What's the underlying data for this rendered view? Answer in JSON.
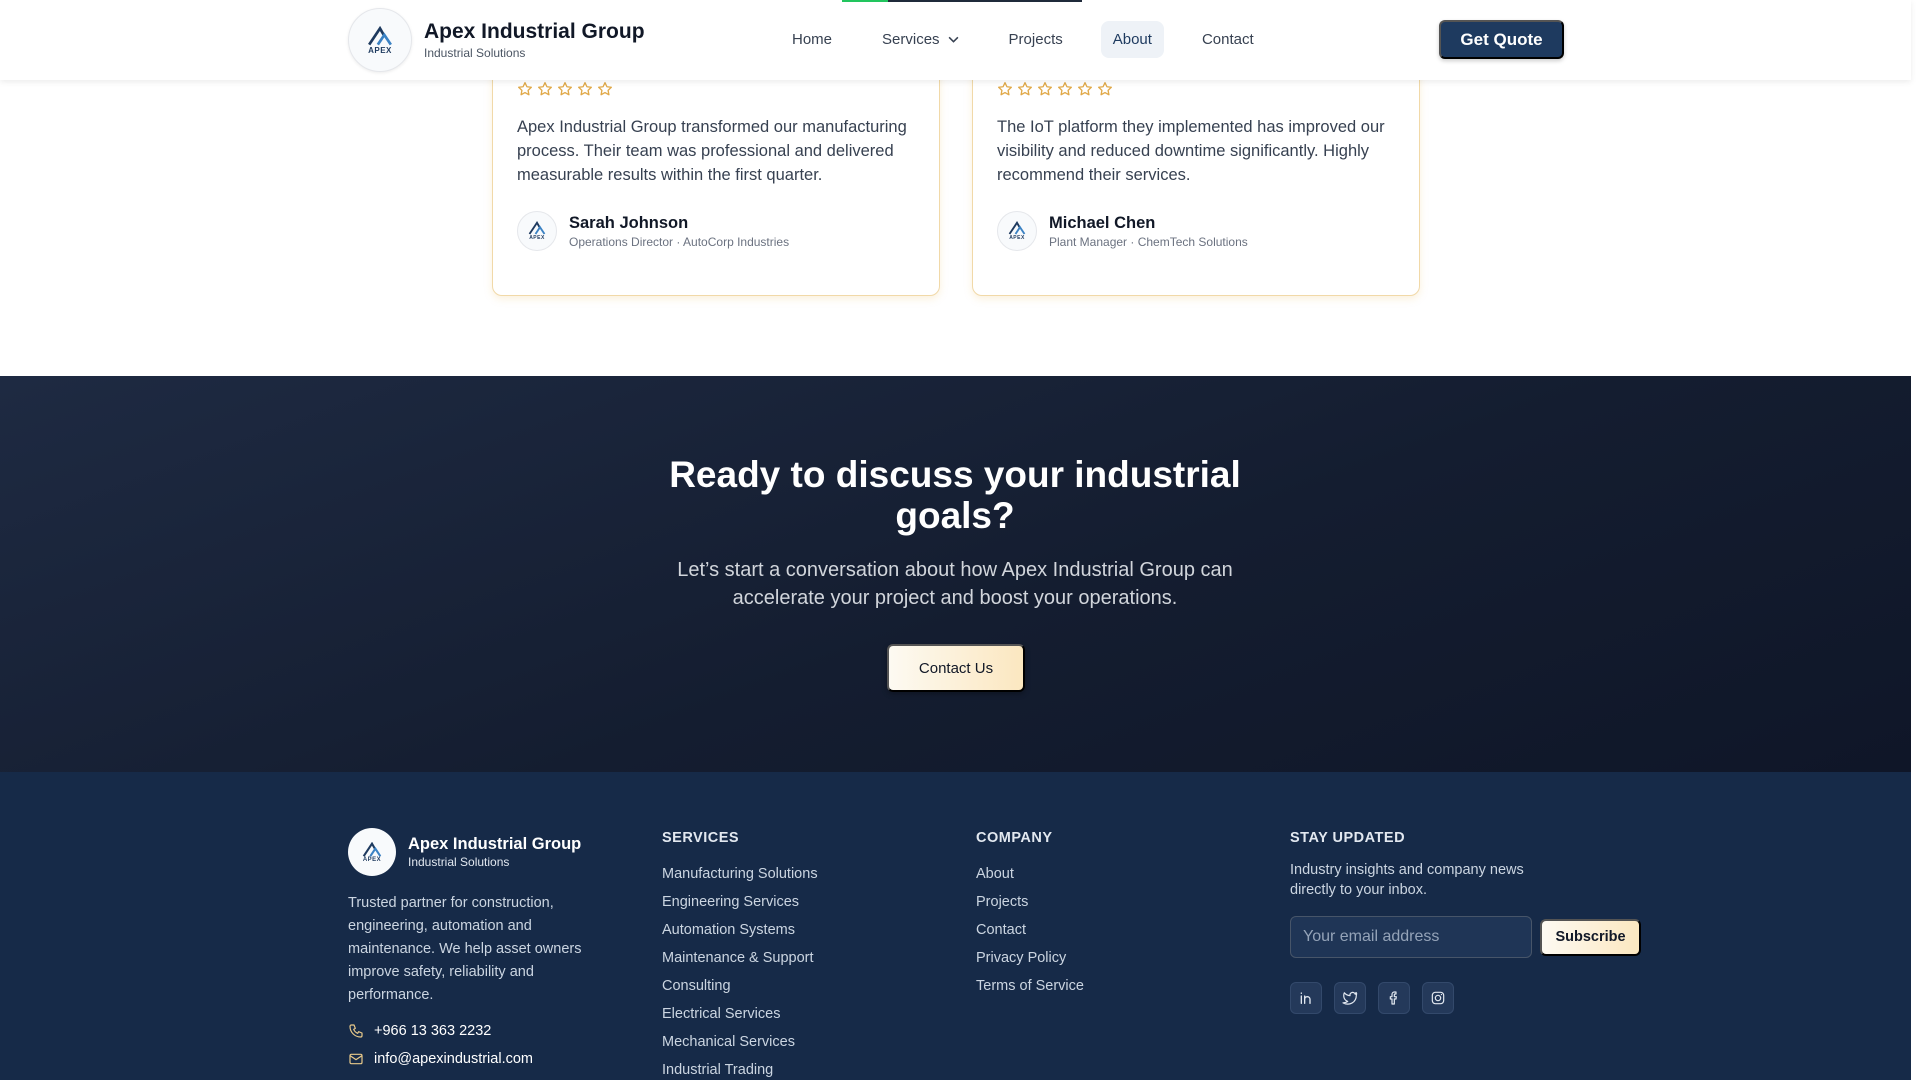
{
  "header": {
    "brand_name": "Apex Industrial Group",
    "brand_sub": "Industrial Solutions",
    "logo_word": "APEX",
    "nav": [
      "Home",
      "Services",
      "Projects",
      "About",
      "Contact"
    ],
    "active_nav": "About",
    "cta_label": "Get Quote"
  },
  "testimonials": [
    {
      "rating": 5,
      "quote": "Apex Industrial Group transformed our manufacturing process. Their team was professional and delivered measurable results within the first quarter.",
      "name": "Sarah Johnson",
      "role": "Operations Director · AutoCorp Industries"
    },
    {
      "rating": 5,
      "quote": "The IoT platform they implemented has improved our visibility and reduced downtime significantly. Highly recommend their services.",
      "name": "Michael Chen",
      "role": "Plant Manager · ChemTech Solutions"
    }
  ],
  "cta": {
    "title": "Ready to discuss your industrial goals?",
    "text": "Let’s start a conversation about how Apex Industrial Group can accelerate your project and boost your operations.",
    "button": "Contact Us"
  },
  "footer": {
    "brand_name": "Apex Industrial Group",
    "brand_sub": "Industrial Solutions",
    "description": "Trusted partner for construction, engineering, automation and maintenance. We help asset owners improve safety, reliability and performance.",
    "phone": "+966 13 363 2232",
    "email": "info@apexindustrial.com",
    "services_title": "SERVICES",
    "services": [
      "Manufacturing Solutions",
      "Engineering Services",
      "Automation Systems",
      "Maintenance & Support",
      "Consulting",
      "Electrical Services",
      "Mechanical Services",
      "Industrial Trading"
    ],
    "company_title": "COMPANY",
    "company": [
      "About",
      "Projects",
      "Contact",
      "Privacy Policy",
      "Terms of Service"
    ],
    "newsletter_title": "STAY UPDATED",
    "newsletter_text": "Industry insights and company news directly to your inbox.",
    "email_placeholder": "Your email address",
    "subscribe_label": "Subscribe",
    "socials": [
      "linkedin-icon",
      "twitter-icon",
      "facebook-icon",
      "instagram-icon"
    ]
  },
  "colors": {
    "brand_navy": "#1e3a5f",
    "star_gold": "#e0a94a",
    "cta_bg": "#141d30",
    "footer_bg": "#162a48",
    "accent_cream": "#fbe7c0",
    "progress_green": "#22c55e"
  }
}
